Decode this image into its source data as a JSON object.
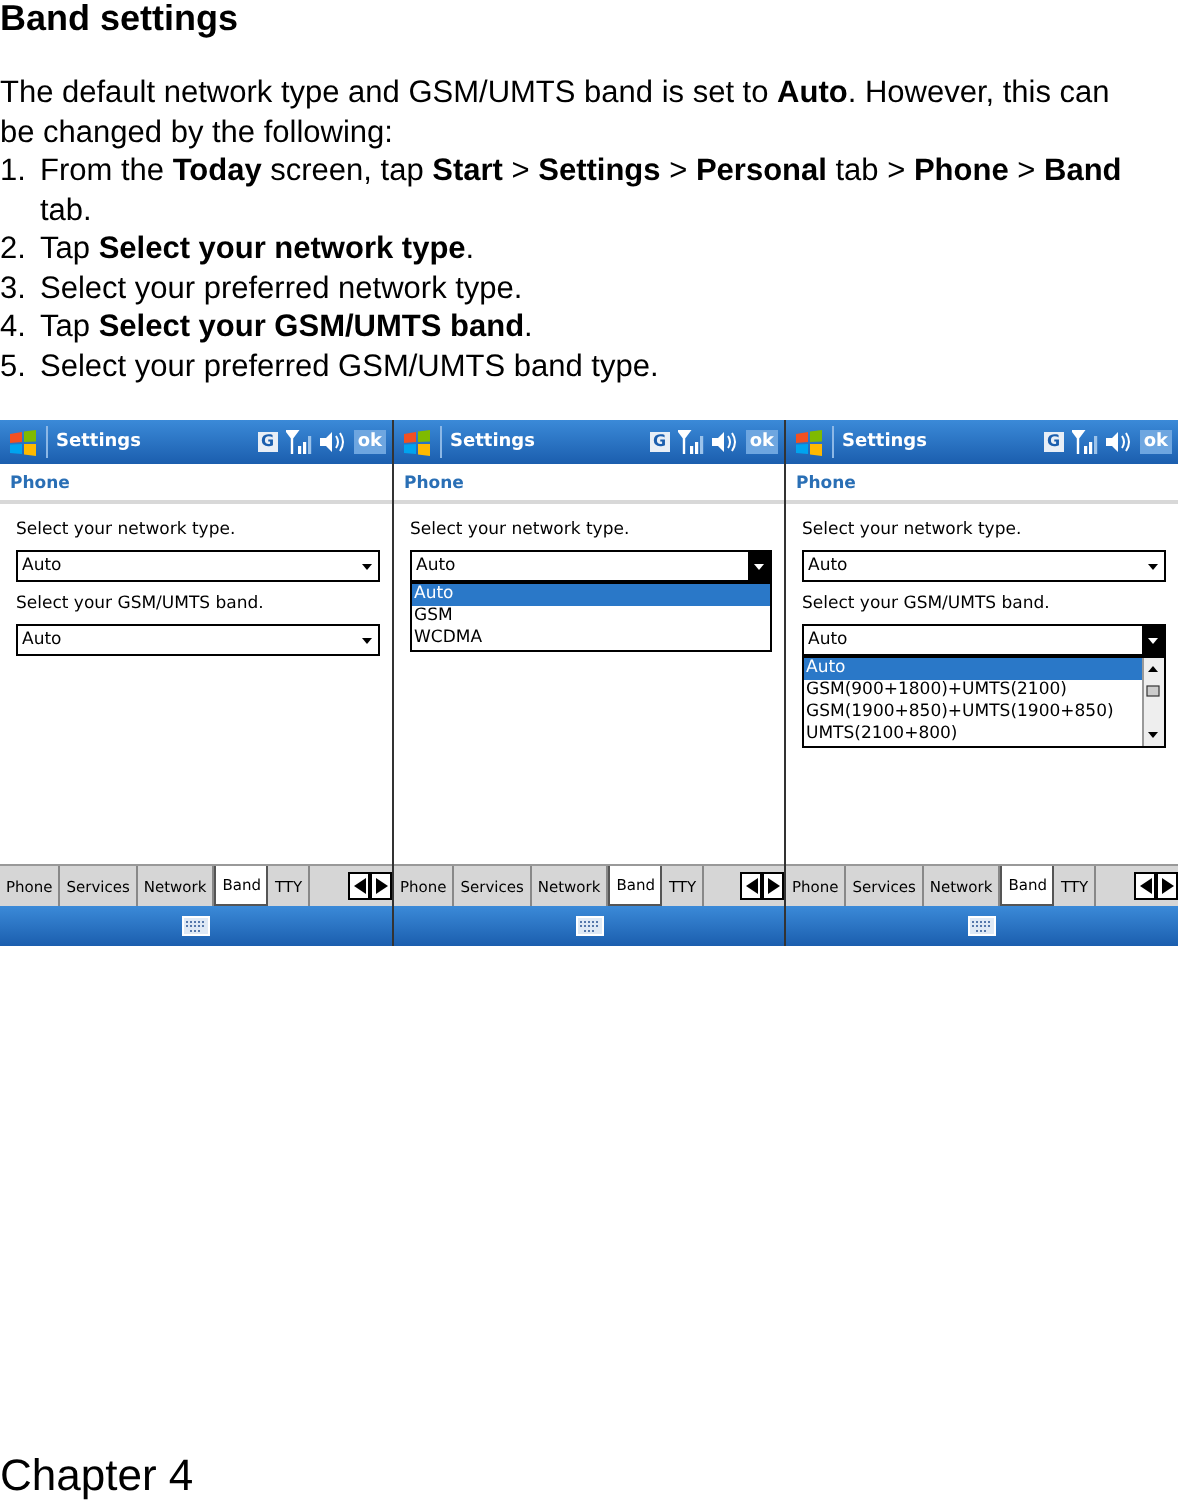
{
  "heading": "Band settings",
  "intro": "The default network type and GSM/UMTS band is set to **Auto**. However, this can be changed by the following:",
  "steps": [
    {
      "number": "1.",
      "text": "From the **Today** screen, tap **Start** > **Settings** > **Personal** tab > **Phone** > **Band** tab."
    },
    {
      "number": "2.",
      "text": "Tap **Select your network type**."
    },
    {
      "number": "3.",
      "text": "Select your preferred network type."
    },
    {
      "number": "4.",
      "text": "Tap **Select your GSM/UMTS band**."
    },
    {
      "number": "5.",
      "text": "Select your preferred GSM/UMTS band type."
    }
  ],
  "screens": [
    {
      "title": "Settings",
      "network_letter": "G",
      "ok": "ok",
      "section": "Phone",
      "fields": [
        {
          "label": "Select your network type.",
          "value": "Auto",
          "open": false
        },
        {
          "label": "Select your GSM/UMTS band.",
          "value": "Auto",
          "open": false
        }
      ],
      "tabs": [
        {
          "label": "Phone",
          "selected": false
        },
        {
          "label": "Services",
          "selected": false
        },
        {
          "label": "Network",
          "selected": false
        },
        {
          "label": "Band",
          "selected": true
        },
        {
          "label": "TTY",
          "selected": false
        }
      ]
    },
    {
      "title": "Settings",
      "network_letter": "G",
      "ok": "ok",
      "section": "Phone",
      "fields": [
        {
          "label": "Select your network type.",
          "value": "Auto",
          "open": true,
          "scrollbar": false,
          "options": [
            {
              "label": "Auto",
              "selected": true
            },
            {
              "label": "GSM",
              "selected": false
            },
            {
              "label": "WCDMA",
              "selected": false
            }
          ]
        }
      ],
      "tabs": [
        {
          "label": "Phone",
          "selected": false
        },
        {
          "label": "Services",
          "selected": false
        },
        {
          "label": "Network",
          "selected": false
        },
        {
          "label": "Band",
          "selected": true
        },
        {
          "label": "TTY",
          "selected": false
        }
      ]
    },
    {
      "title": "Settings",
      "network_letter": "G",
      "ok": "ok",
      "section": "Phone",
      "fields": [
        {
          "label": "Select your network type.",
          "value": "Auto",
          "open": false
        },
        {
          "label": "Select your GSM/UMTS band.",
          "value": "Auto",
          "open": true,
          "scrollbar": true,
          "options": [
            {
              "label": "Auto",
              "selected": true
            },
            {
              "label": "GSM(900+1800)+UMTS(2100)",
              "selected": false
            },
            {
              "label": "GSM(1900+850)+UMTS(1900+850)",
              "selected": false
            },
            {
              "label": "UMTS(2100+800)",
              "selected": false
            }
          ]
        }
      ],
      "tabs": [
        {
          "label": "Phone",
          "selected": false
        },
        {
          "label": "Services",
          "selected": false
        },
        {
          "label": "Network",
          "selected": false
        },
        {
          "label": "Band",
          "selected": true
        },
        {
          "label": "TTY",
          "selected": false
        }
      ]
    }
  ],
  "footer": "Chapter 4"
}
